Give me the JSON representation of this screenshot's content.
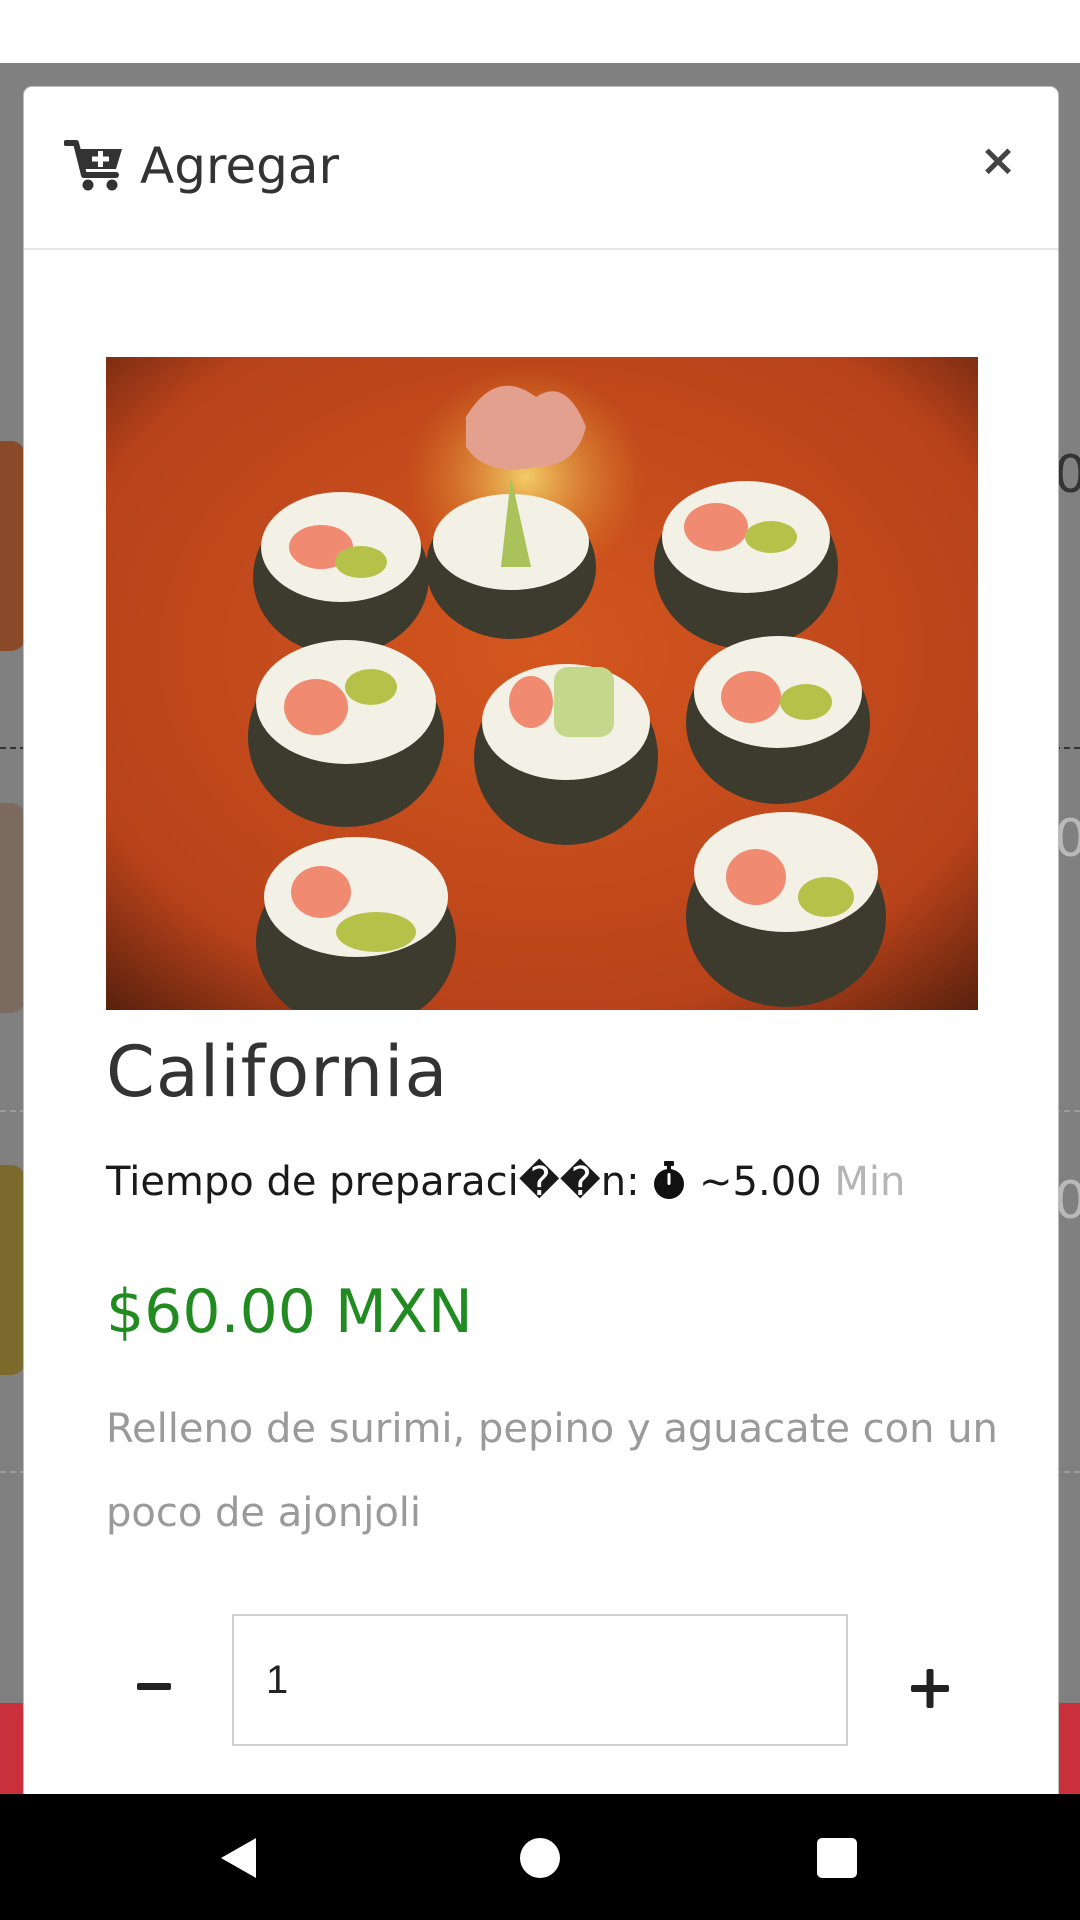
{
  "modal": {
    "title": "Agregar",
    "close_label": "×",
    "header_icon": "cart-plus-icon"
  },
  "product": {
    "name": "California",
    "prep_label": "Tiempo de preparaci��n:",
    "prep_time": "~5.00",
    "prep_unit": "Min",
    "prep_icon": "stopwatch-icon",
    "price": "$60.00 MXN",
    "description": "Relleno de surimi, pepino y aguacate con un poco de ajonjoli",
    "image_alt": "california-roll-photo"
  },
  "quantity": {
    "value": "1",
    "minus_icon": "minus-icon",
    "plus_icon": "plus-icon"
  },
  "background_list": {
    "price_glyph": "0"
  },
  "colors": {
    "price": "#218a21",
    "backdrop": "#808080",
    "accent_bar": "#c9303c",
    "unit_text": "#b5b5b5"
  }
}
